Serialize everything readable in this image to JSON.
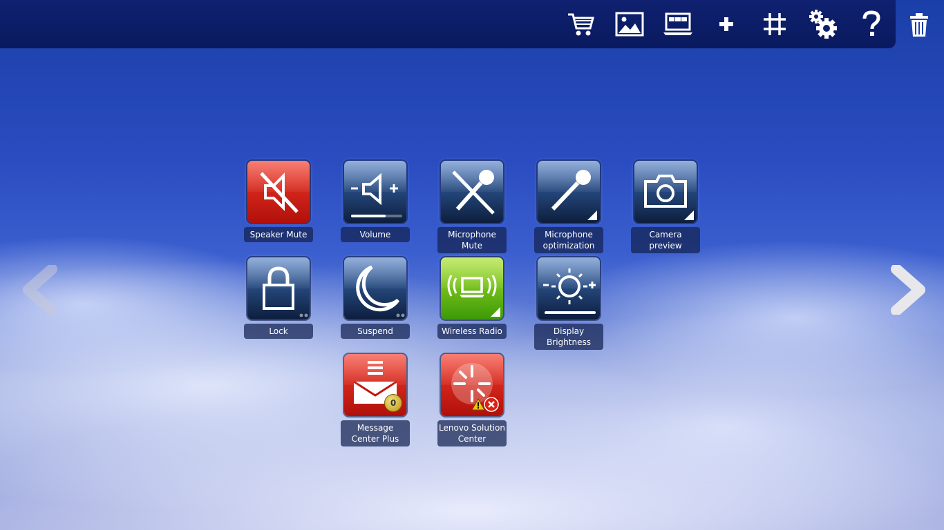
{
  "toolbar": {
    "items": [
      {
        "icon": "shopping-cart-icon"
      },
      {
        "icon": "picture-icon"
      },
      {
        "icon": "laptop-icon"
      },
      {
        "icon": "plus-icon"
      },
      {
        "icon": "grid-icon"
      },
      {
        "icon": "gears-icon"
      },
      {
        "icon": "help-icon"
      }
    ],
    "trash_icon": "trash-icon"
  },
  "tiles": [
    {
      "label": "Speaker Mute",
      "color": "#d81a12"
    },
    {
      "label": "Volume",
      "color": "#234478"
    },
    {
      "label": "Microphone Mute",
      "color": "#234478"
    },
    {
      "label": "Microphone optimization",
      "color": "#234478"
    },
    {
      "label": "Camera preview",
      "color": "#234478"
    },
    {
      "label": "Lock",
      "color": "#234478"
    },
    {
      "label": "Suspend",
      "color": "#234478"
    },
    {
      "label": "Wireless Radio",
      "color": "#6cc012"
    },
    {
      "label": "Display Brightness",
      "color": "#234478"
    },
    {
      "label": "Message Center Plus",
      "color": "#d81a12",
      "badge": "0"
    },
    {
      "label": "Lenovo Solution Center",
      "color": "#d81a12"
    }
  ],
  "colors": {
    "topbar": "#0a1a5f",
    "sky": "#2a4cc0"
  }
}
